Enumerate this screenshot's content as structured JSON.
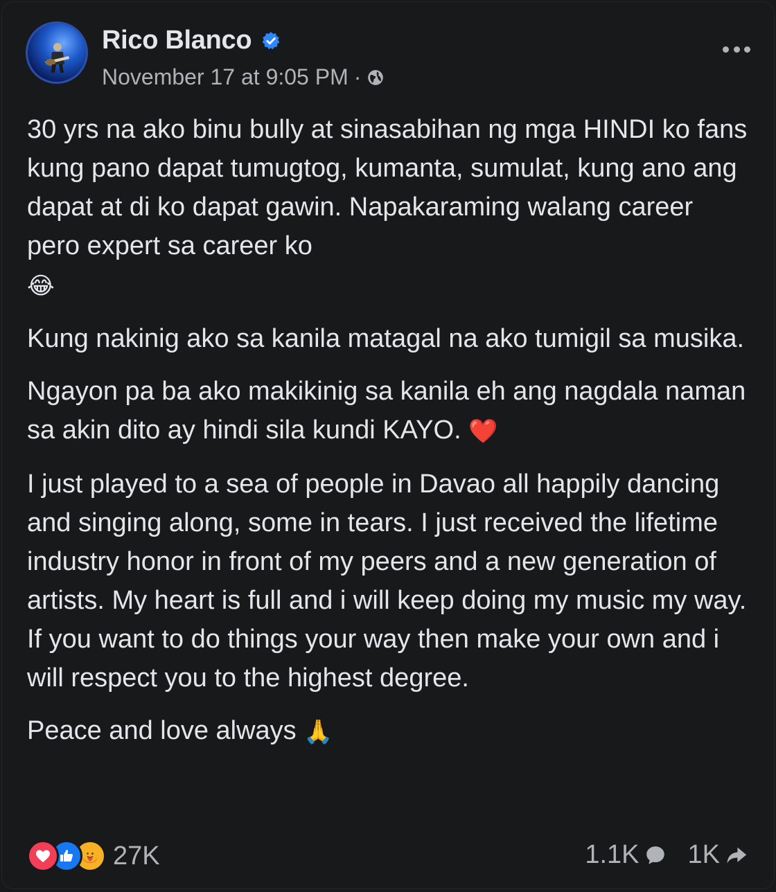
{
  "post": {
    "author": "Rico Blanco",
    "timestamp": "November 17 at 9:05 PM",
    "separator": "·",
    "privacy_icon": "globe-icon",
    "verified_icon": "verified-badge-icon",
    "more_icon": "more-options-icon",
    "paragraphs": [
      {
        "text": "30 yrs na ako binu bully at sinasabihan ng mga HINDI ko fans kung pano dapat tumugtog, kumanta, sumulat, kung ano ang dapat at di ko dapat gawin. Napakaraming walang career pero expert sa career ko",
        "emoji": "😂"
      },
      {
        "text": "Kung nakinig ako sa kanila matagal na ako tumigil sa musika."
      },
      {
        "text": "Ngayon pa ba ako makikinig sa kanila eh ang nagdala naman sa akin dito ay hindi sila kundi KAYO.",
        "emoji": "❤️"
      },
      {
        "text": "I just played to a sea of people in Davao all happily dancing and singing along, some in tears. I just received the lifetime industry honor in front of my peers and a new generation of artists. My heart is full and i will keep doing my music my way. If you want to do things your way then make your own and i will respect you to the highest degree."
      },
      {
        "text": "Peace and love always",
        "emoji": "🙏"
      }
    ]
  },
  "footer": {
    "reactions": [
      "love-reaction-icon",
      "like-reaction-icon",
      "care-reaction-icon"
    ],
    "reaction_count": "27K",
    "comment_count": "1.1K",
    "share_count": "1K"
  },
  "colors": {
    "background": "#18191a",
    "text": "#e4e6eb",
    "secondary_text": "#b0b3b8",
    "verified": "#2d88ff",
    "love": "#f33e58",
    "like": "#1877f2",
    "care": "#f7b125"
  }
}
